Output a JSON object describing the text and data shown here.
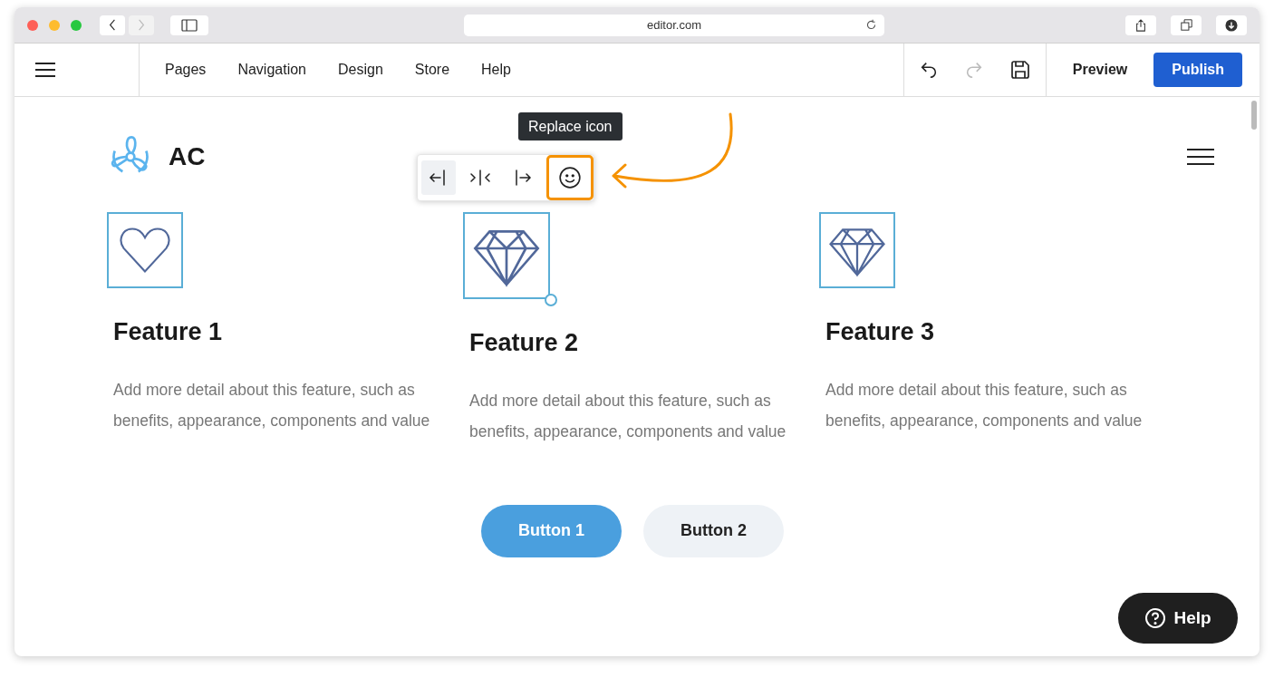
{
  "browser": {
    "url": "editor.com"
  },
  "nav": [
    {
      "label": "Pages"
    },
    {
      "label": "Navigation"
    },
    {
      "label": "Design"
    },
    {
      "label": "Store"
    },
    {
      "label": "Help"
    }
  ],
  "history": {
    "undo_disabled": false,
    "redo_disabled": true
  },
  "actions": [
    {
      "label": "Preview",
      "kind": "text"
    },
    {
      "label": "Publish",
      "kind": "primary"
    }
  ],
  "site": {
    "logo_text": "AC"
  },
  "tooltip": "Replace icon",
  "align_toolbar": [
    {
      "kind": "left",
      "selected": true,
      "highlighted": false
    },
    {
      "kind": "center",
      "selected": false,
      "highlighted": false
    },
    {
      "kind": "right",
      "selected": false,
      "highlighted": false
    },
    {
      "kind": "smiley",
      "selected": false,
      "highlighted": true
    }
  ],
  "features": [
    {
      "kind": "heart",
      "selected": false,
      "title": "Feature 1",
      "text": "Add more detail about this feature, such as benefits, appearance, components and value"
    },
    {
      "kind": "diamond",
      "selected": true,
      "title": "Feature 2",
      "text": "Add more detail about this feature, such as benefits, appearance, components and value"
    },
    {
      "kind": "diamond",
      "selected": false,
      "title": "Feature 3",
      "text": "Add more detail about this feature, such as benefits, appearance, components and value"
    }
  ],
  "buttons": [
    {
      "label": "Button 1",
      "kind": "primary"
    },
    {
      "label": "Button 2",
      "kind": "secondary"
    }
  ],
  "help_button": {
    "label": "Help"
  }
}
